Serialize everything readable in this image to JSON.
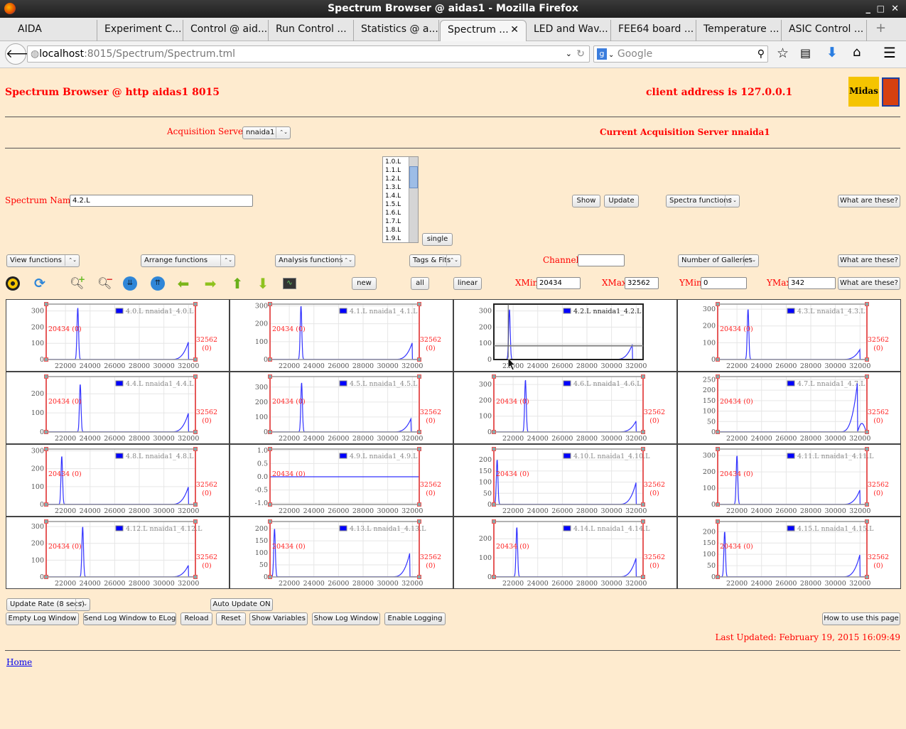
{
  "window": {
    "title": "Spectrum Browser @ aidas1 - Mozilla Firefox"
  },
  "tabs": [
    {
      "label": "AIDA"
    },
    {
      "label": "Experiment C..."
    },
    {
      "label": "Control @ aid..."
    },
    {
      "label": "Run Control ..."
    },
    {
      "label": "Statistics @ a..."
    },
    {
      "label": "Spectrum ...",
      "active": true
    },
    {
      "label": "LED and Wav..."
    },
    {
      "label": "FEE64 board ..."
    },
    {
      "label": "Temperature ..."
    },
    {
      "label": "ASIC Control ..."
    }
  ],
  "nav": {
    "url_host": "localhost",
    "url_path": ":8015/Spectrum/Spectrum.tml",
    "search_placeholder": "Google"
  },
  "header": {
    "title": "Spectrum Browser @ http aidas1 8015",
    "client": "client address is 127.0.0.1",
    "logo": "Midas"
  },
  "acq": {
    "label": "Acquisition Servers",
    "server": "nnaida1",
    "current": "Current Acquisition Server nnaida1"
  },
  "spectrum": {
    "label": "Spectrum Name:",
    "value": "4.2.L",
    "list": [
      "1.0.L",
      "1.1.L",
      "1.2.L",
      "1.3.L",
      "1.4.L",
      "1.5.L",
      "1.6.L",
      "1.7.L",
      "1.8.L",
      "1.9.L"
    ],
    "single": "single",
    "show": "Show",
    "update": "Update",
    "functions": "Spectra functions",
    "what": "What are these?"
  },
  "toolbar": {
    "view": "View functions",
    "arrange": "Arrange functions",
    "analysis": "Analysis functions",
    "tags": "Tags & Fits",
    "channel_label": "Channel:",
    "channel_value": "",
    "galleries": "Number of Galleries",
    "what": "What are these?",
    "new": "new",
    "all": "all",
    "linear": "linear",
    "xmin_label": "XMin",
    "xmin": "20434",
    "xmax_label": "XMax",
    "xmax": "32562",
    "ymin_label": "YMin",
    "ymin": "0",
    "ymax_label": "YMax",
    "ymax": "342",
    "what2": "What are these?"
  },
  "icons": [
    "radiation-icon",
    "refresh-icon",
    "zoom-in-icon",
    "zoom-out-icon",
    "expand-vertical-icon",
    "compress-vertical-icon",
    "arrow-left-icon",
    "arrow-right-icon",
    "arrow-up-icon",
    "arrow-down-icon",
    "monitor-icon"
  ],
  "chart_data": [
    {
      "type": "line",
      "legend": "4.0.L nnaida1_4.0.L",
      "xlim": [
        20434,
        32562
      ],
      "ylim": [
        0,
        342
      ],
      "yticks": [
        "0",
        "100",
        "200",
        "300"
      ],
      "xticks": [
        "22000",
        "24000",
        "26000",
        "28000",
        "30000",
        "32000"
      ],
      "peak": [
        23000,
        320
      ],
      "tail": [
        32000,
        110
      ],
      "left_marker": "20434 (0)",
      "right_marker": [
        "32562",
        "(0)"
      ]
    },
    {
      "type": "line",
      "legend": "4.1.L nnaida1_4.1.L",
      "xlim": [
        20434,
        32562
      ],
      "ylim": [
        0,
        310
      ],
      "yticks": [
        "0",
        "100",
        "200",
        "300"
      ],
      "xticks": [
        "22000",
        "24000",
        "26000",
        "28000",
        "30000",
        "32000"
      ],
      "peak": [
        22950,
        300
      ],
      "tail": [
        32000,
        95
      ],
      "left_marker": "20434 (0)",
      "right_marker": [
        "32562",
        "(0)"
      ]
    },
    {
      "type": "line",
      "legend": "4.2.L nnaida1_4.2.L",
      "xlim": [
        20434,
        32562
      ],
      "ylim": [
        0,
        342
      ],
      "yticks": [
        "0",
        "100",
        "200",
        "300"
      ],
      "xticks": [
        "22000",
        "24000",
        "26000",
        "28000",
        "30000",
        "32000"
      ],
      "peak": [
        21700,
        310
      ],
      "tail": [
        31700,
        95
      ],
      "selected": true
    },
    {
      "type": "line",
      "legend": "4.3.L nnaida1_4.3.L",
      "xlim": [
        20434,
        32562
      ],
      "ylim": [
        0,
        330
      ],
      "yticks": [
        "0",
        "100",
        "200",
        "300"
      ],
      "xticks": [
        "22000",
        "24000",
        "26000",
        "28000",
        "30000",
        "32000"
      ],
      "peak": [
        22900,
        300
      ],
      "tail": [
        32000,
        60
      ],
      "left_marker": "20434 (0)",
      "right_marker": [
        "32562",
        "(0)"
      ]
    },
    {
      "type": "line",
      "legend": "4.4.L nnaida1_4.4.L",
      "xlim": [
        20434,
        32562
      ],
      "ylim": [
        0,
        290
      ],
      "yticks": [
        "0",
        "100",
        "200"
      ],
      "xticks": [
        "22000",
        "24000",
        "26000",
        "28000",
        "30000",
        "32000"
      ],
      "peak": [
        23200,
        250
      ],
      "tail": [
        32000,
        100
      ],
      "left_marker": "20434 (0)",
      "right_marker": [
        "32562",
        "(0)"
      ]
    },
    {
      "type": "line",
      "legend": "4.5.L nnaida1_4.5.L",
      "xlim": [
        20434,
        32562
      ],
      "ylim": [
        0,
        370
      ],
      "yticks": [
        "0",
        "100",
        "200",
        "300"
      ],
      "xticks": [
        "22000",
        "24000",
        "26000",
        "28000",
        "30000",
        "32000"
      ],
      "peak": [
        23000,
        330
      ],
      "tail": [
        31900,
        90
      ],
      "left_marker": "20434 (0)",
      "right_marker": [
        "32562",
        "(0)"
      ]
    },
    {
      "type": "line",
      "legend": "4.6.L nnaida1_4.6.L",
      "xlim": [
        20434,
        32562
      ],
      "ylim": [
        0,
        350
      ],
      "yticks": [
        "0",
        "100",
        "200",
        "300"
      ],
      "xticks": [
        "22000",
        "24000",
        "26000",
        "28000",
        "30000",
        "32000"
      ],
      "peak": [
        23000,
        330
      ],
      "tail": [
        32000,
        70
      ],
      "left_marker": "20434 (0)",
      "right_marker": [
        "32562",
        "(0)"
      ]
    },
    {
      "type": "line",
      "legend": "4.7.L nnaida1_4.7.L",
      "xlim": [
        20434,
        32562
      ],
      "ylim": [
        0,
        265
      ],
      "yticks": [
        "0",
        "50",
        "100",
        "150",
        "200",
        "250"
      ],
      "xticks": [
        "22000",
        "24000",
        "26000",
        "28000",
        "30000",
        "32000"
      ],
      "peak": null,
      "tail": [
        31800,
        240
      ],
      "left_marker": "20434 (0)",
      "right_marker": [
        "32562",
        "(0)"
      ]
    },
    {
      "type": "line",
      "legend": "4.8.L nnaida1_4.8.L",
      "xlim": [
        20434,
        32562
      ],
      "ylim": [
        0,
        310
      ],
      "yticks": [
        "0",
        "100",
        "200",
        "300"
      ],
      "xticks": [
        "22000",
        "24000",
        "26000",
        "28000",
        "30000",
        "32000"
      ],
      "peak": [
        21700,
        270
      ],
      "tail": [
        32000,
        100
      ],
      "left_marker": "20434 (0)",
      "right_marker": [
        "32562",
        "(0)"
      ]
    },
    {
      "type": "line",
      "legend": "4.9.L nnaida1_4.9.L",
      "xlim": [
        20434,
        32562
      ],
      "ylim": [
        -1.05,
        1.05
      ],
      "yticks": [
        "-1.0",
        "-0.5",
        "0.0",
        "0.5",
        "1.0"
      ],
      "xticks": [
        "22000",
        "24000",
        "26000",
        "28000",
        "30000",
        "32000"
      ],
      "peak": null,
      "tail": null,
      "left_marker": "20434 (0)",
      "right_marker": [
        "32562",
        "(0)"
      ]
    },
    {
      "type": "line",
      "legend": "4.10.L nnaida1_4.10.L",
      "xlim": [
        20434,
        32562
      ],
      "ylim": [
        0,
        248
      ],
      "yticks": [
        "0",
        "50",
        "100",
        "150",
        "200"
      ],
      "xticks": [
        "22000",
        "24000",
        "26000",
        "28000",
        "30000",
        "32000"
      ],
      "peak": [
        20700,
        200
      ],
      "tail": [
        32000,
        100
      ],
      "left_marker": "20434 (0)",
      "right_marker": [
        "32562",
        "(0)"
      ]
    },
    {
      "type": "line",
      "legend": "4.11.L nnaida1_4.11.L",
      "xlim": [
        20434,
        32562
      ],
      "ylim": [
        0,
        340
      ],
      "yticks": [
        "0",
        "100",
        "200",
        "300"
      ],
      "xticks": [
        "22000",
        "24000",
        "26000",
        "28000",
        "30000",
        "32000"
      ],
      "peak": [
        22000,
        300
      ],
      "tail": [
        32000,
        90
      ],
      "left_marker": "20434 (0)",
      "right_marker": [
        "32562",
        "(0)"
      ]
    },
    {
      "type": "line",
      "legend": "4.12.L nnaida1_4.12.L",
      "xlim": [
        20434,
        32562
      ],
      "ylim": [
        0,
        330
      ],
      "yticks": [
        "0",
        "100",
        "200",
        "300"
      ],
      "xticks": [
        "22000",
        "24000",
        "26000",
        "28000",
        "30000",
        "32000"
      ],
      "peak": [
        23400,
        300
      ],
      "tail": [
        32000,
        70
      ],
      "left_marker": "20434 (0)",
      "right_marker": [
        "32562",
        "(0)"
      ]
    },
    {
      "type": "line",
      "legend": "4.13.L nnaida1_4.13.L",
      "xlim": [
        20434,
        32562
      ],
      "ylim": [
        0,
        230
      ],
      "yticks": [
        "0",
        "50",
        "100",
        "150",
        "200"
      ],
      "xticks": [
        "22000",
        "24000",
        "26000",
        "28000",
        "30000",
        "32000"
      ],
      "peak": [
        20800,
        200
      ],
      "tail": [
        31800,
        100
      ],
      "left_marker": "20434 (0)",
      "right_marker": [
        "32562",
        "(0)"
      ]
    },
    {
      "type": "line",
      "legend": "4.14.L nnaida1_4.14.L",
      "xlim": [
        20434,
        32562
      ],
      "ylim": [
        0,
        290
      ],
      "yticks": [
        "0",
        "100",
        "200"
      ],
      "xticks": [
        "22000",
        "24000",
        "26000",
        "28000",
        "30000",
        "32000"
      ],
      "peak": [
        22300,
        260
      ],
      "tail": [
        32000,
        100
      ],
      "left_marker": "20434 (0)",
      "right_marker": [
        "32562",
        "(0)"
      ]
    },
    {
      "type": "line",
      "legend": "4.15.L nnaida1_4.15.L",
      "xlim": [
        20434,
        32562
      ],
      "ylim": [
        0,
        245
      ],
      "yticks": [
        "0",
        "50",
        "100",
        "150",
        "200"
      ],
      "xticks": [
        "22000",
        "24000",
        "26000",
        "28000",
        "30000",
        "32000"
      ],
      "peak": [
        21000,
        200
      ],
      "tail": [
        32000,
        100
      ],
      "left_marker": "20434 (0)",
      "right_marker": [
        "32562",
        "(0)"
      ]
    }
  ],
  "footer": {
    "rate": "Update Rate (8 secs)",
    "auto": "Auto Update ON",
    "empty": "Empty Log Window",
    "send": "Send Log Window to ELog",
    "reload": "Reload",
    "reset": "Reset",
    "vars": "Show Variables",
    "showlog": "Show Log Window",
    "logging": "Enable Logging",
    "howto": "How to use this page",
    "updated": "Last Updated: February 19, 2015 16:09:49",
    "home": "Home"
  },
  "colors": {
    "page_bg": "#feebcf",
    "accent_red": "#ff0000",
    "series": "#3333ff"
  }
}
